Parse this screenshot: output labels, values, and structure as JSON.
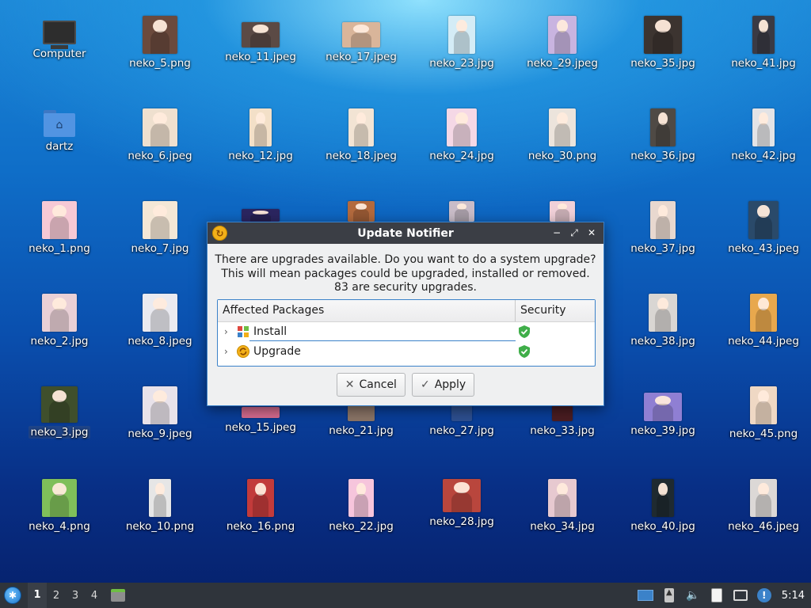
{
  "desktop": {
    "computer": "Computer",
    "home_folder": "dartz",
    "files": [
      {
        "name": "neko_1.png",
        "color": "#f6c9d5"
      },
      {
        "name": "neko_2.jpg",
        "color": "#e9d0d6"
      },
      {
        "name": "neko_3.jpg",
        "color": "#3f4f2c"
      },
      {
        "name": "neko_4.png",
        "color": "#7fbf5a"
      },
      {
        "name": "neko_5.png",
        "color": "#6b4a3d"
      },
      {
        "name": "neko_6.jpeg",
        "color": "#efe0cf"
      },
      {
        "name": "neko_7.jpg",
        "color": "#f4e7d6"
      },
      {
        "name": "neko_8.jpeg",
        "color": "#eaeaf0"
      },
      {
        "name": "neko_9.jpeg",
        "color": "#e8e2ea"
      },
      {
        "name": "neko_10.png",
        "color": "#e6e6e6"
      },
      {
        "name": "neko_11.jpeg",
        "color": "#5b4a45"
      },
      {
        "name": "neko_12.jpg",
        "color": "#f3e0c8"
      },
      {
        "name": "neko_15.jpeg",
        "color": "#d46a8d"
      },
      {
        "name": "neko_16.png",
        "color": "#c23b3b"
      },
      {
        "name": "neko_17.jpeg",
        "color": "#d9b59a"
      },
      {
        "name": "neko_18.jpeg",
        "color": "#f2e4d4"
      },
      {
        "name": "neko_21.jpg",
        "color": "#8a7466"
      },
      {
        "name": "neko_22.jpg",
        "color": "#f6c5dc"
      },
      {
        "name": "neko_23.jpg",
        "color": "#d4ecf6"
      },
      {
        "name": "neko_24.jpg",
        "color": "#f5d8e6"
      },
      {
        "name": "neko_27.jpg",
        "color": "#2d4f8f"
      },
      {
        "name": "neko_28.jpg",
        "color": "#b9463d"
      },
      {
        "name": "neko_29.jpeg",
        "color": "#c9b4e0"
      },
      {
        "name": "neko_30.png",
        "color": "#ece4dc"
      },
      {
        "name": "neko_33.jpg",
        "color": "#4a1d22"
      },
      {
        "name": "neko_34.jpg",
        "color": "#e7c9d0"
      },
      {
        "name": "neko_35.jpg",
        "color": "#3c3430"
      },
      {
        "name": "neko_36.jpg",
        "color": "#4f4a45"
      },
      {
        "name": "neko_37.jpg",
        "color": "#e8d8cf"
      },
      {
        "name": "neko_38.jpg",
        "color": "#d9d6d3"
      },
      {
        "name": "neko_39.jpg",
        "color": "#8f7fd3"
      },
      {
        "name": "neko_40.jpg",
        "color": "#1f2a30"
      },
      {
        "name": "neko_41.jpg",
        "color": "#3a3a44"
      },
      {
        "name": "neko_42.jpg",
        "color": "#e3e3e6"
      },
      {
        "name": "neko_43.jpeg",
        "color": "#2a4a6a"
      },
      {
        "name": "neko_44.jpeg",
        "color": "#e8a84d"
      },
      {
        "name": "neko_45.png",
        "color": "#efd8c4"
      },
      {
        "name": "neko_46.jpeg",
        "color": "#dcd8d6"
      },
      {
        "name": "",
        "color": "#2b2560"
      },
      {
        "name": "",
        "color": "#b36a3e"
      },
      {
        "name": "",
        "color": "#c9bcc8"
      },
      {
        "name": "",
        "color": "#f0d0d8"
      }
    ]
  },
  "dialog": {
    "title": "Update Notifier",
    "message_line1": "There are upgrades available. Do you want to do a system upgrade?",
    "message_line2": "This will mean packages could be upgraded, installed or removed.",
    "message_line3": "83 are security upgrades.",
    "col_packages": "Affected Packages",
    "col_security": "Security",
    "rows": [
      {
        "label": "Install"
      },
      {
        "label": "Upgrade"
      }
    ],
    "cancel_label": "Cancel",
    "apply_label": "Apply"
  },
  "taskbar": {
    "workspaces": [
      "1",
      "2",
      "3",
      "4"
    ],
    "active_workspace": "1",
    "clock": "5:14"
  },
  "colors": {
    "accent": "#3b82c9",
    "titlebar": "#3b3e45",
    "taskbar": "#2f343b",
    "shield": "#3fae49"
  }
}
